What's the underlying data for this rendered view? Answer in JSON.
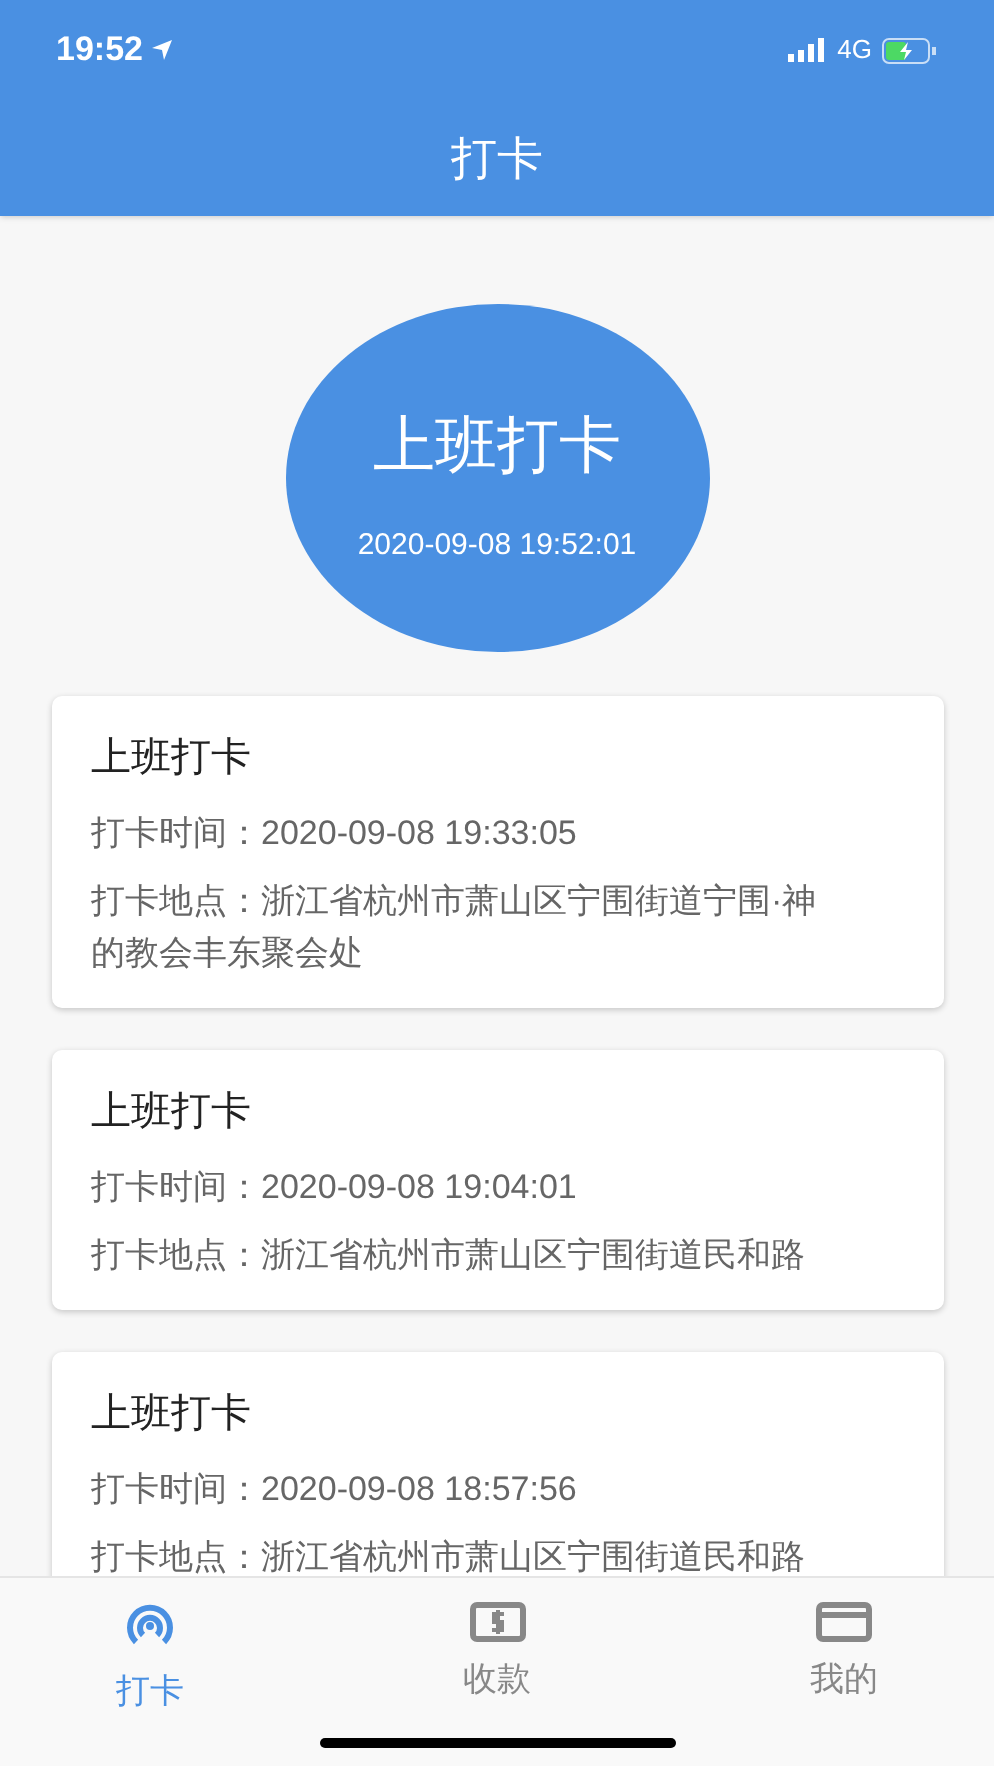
{
  "status_bar": {
    "time": "19:52",
    "network": "4G"
  },
  "header": {
    "title": "打卡"
  },
  "punch_button": {
    "label": "上班打卡",
    "time": "2020-09-08 19:52:01"
  },
  "records": [
    {
      "title": "上班打卡",
      "time_label": "打卡时间：",
      "time": "2020-09-08 19:33:05",
      "place_label": "打卡地点：",
      "place": "浙江省杭州市萧山区宁围街道宁围·神的教会丰东聚会处"
    },
    {
      "title": "上班打卡",
      "time_label": "打卡时间：",
      "time": "2020-09-08 19:04:01",
      "place_label": "打卡地点：",
      "place": "浙江省杭州市萧山区宁围街道民和路"
    },
    {
      "title": "上班打卡",
      "time_label": "打卡时间：",
      "time": "2020-09-08 18:57:56",
      "place_label": "打卡地点：",
      "place": "浙江省杭州市萧山区宁围街道民和路"
    }
  ],
  "tabs": [
    {
      "kind": "signal",
      "label": "打卡",
      "selected": true
    },
    {
      "kind": "money",
      "label": "收款",
      "selected": false
    },
    {
      "kind": "card",
      "label": "我的",
      "selected": false
    }
  ]
}
